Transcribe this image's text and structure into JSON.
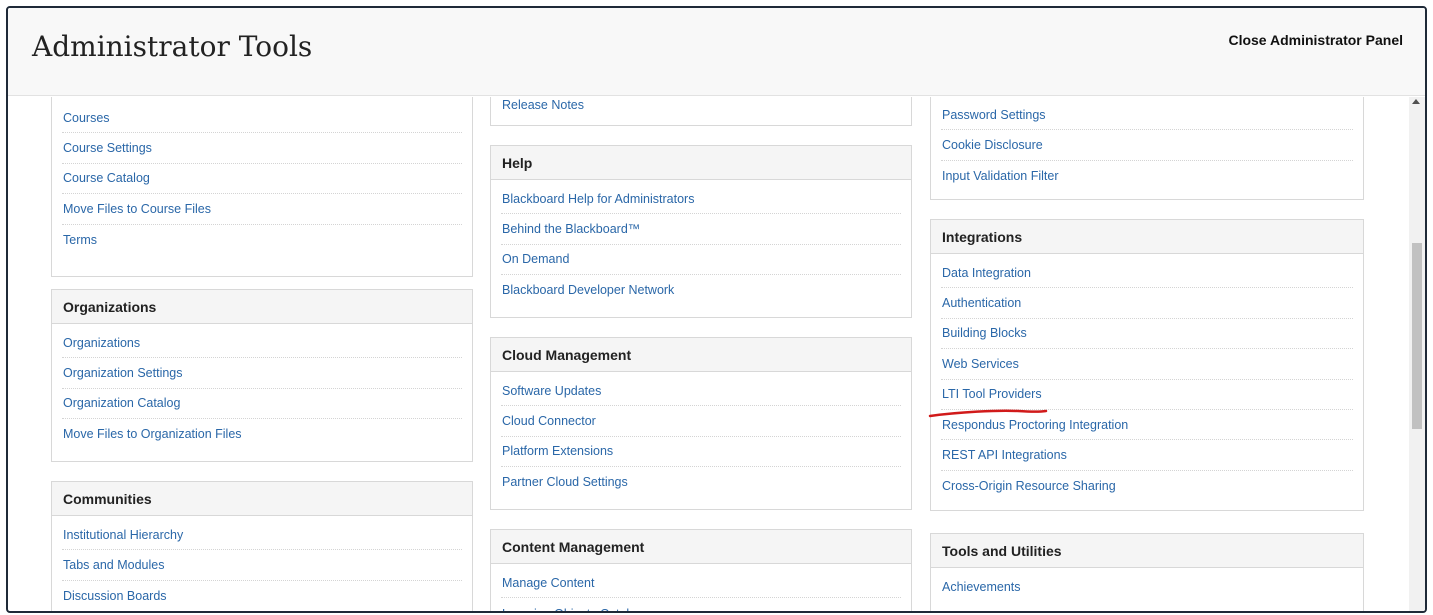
{
  "header": {
    "title": "Administrator Tools",
    "close_label": "Close Administrator Panel"
  },
  "col1": {
    "courses": {
      "items": [
        "Courses",
        "Course Settings",
        "Course Catalog",
        "Move Files to Course Files",
        "Terms"
      ]
    },
    "organizations": {
      "title": "Organizations",
      "items": [
        "Organizations",
        "Organization Settings",
        "Organization Catalog",
        "Move Files to Organization Files"
      ]
    },
    "communities": {
      "title": "Communities",
      "items": [
        "Institutional Hierarchy",
        "Tabs and Modules",
        "Discussion Boards"
      ]
    }
  },
  "col2": {
    "top": {
      "items": [
        "Release Notes"
      ]
    },
    "help": {
      "title": "Help",
      "items": [
        "Blackboard Help for Administrators",
        "Behind the Blackboard™",
        "On Demand",
        "Blackboard Developer Network"
      ]
    },
    "cloud": {
      "title": "Cloud Management",
      "items": [
        "Software Updates",
        "Cloud Connector",
        "Platform Extensions",
        "Partner Cloud Settings"
      ]
    },
    "content": {
      "title": "Content Management",
      "items": [
        "Manage Content",
        "Learning Objects Catalog"
      ]
    }
  },
  "col3": {
    "security": {
      "items": [
        "Password Settings",
        "Cookie Disclosure",
        "Input Validation Filter"
      ]
    },
    "integrations": {
      "title": "Integrations",
      "items": [
        "Data Integration",
        "Authentication",
        "Building Blocks",
        "Web Services",
        "LTI Tool Providers",
        "Respondus Proctoring Integration",
        "REST API Integrations",
        "Cross-Origin Resource Sharing"
      ]
    },
    "tools": {
      "title": "Tools and Utilities",
      "items": [
        "Achievements"
      ]
    }
  },
  "colors": {
    "link": "#2a67a8",
    "annotation": "#d11a1a"
  }
}
